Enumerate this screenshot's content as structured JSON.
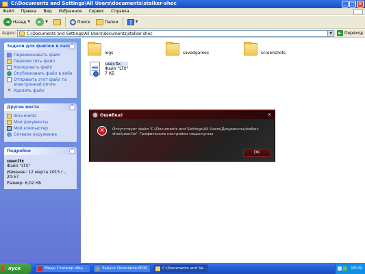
{
  "window": {
    "title": "C:\\Documents and Settings\\All Users\\documents\\stalker-shoc"
  },
  "menu": [
    "Файл",
    "Правка",
    "Вид",
    "Избранное",
    "Сервис",
    "Справка"
  ],
  "toolbar": {
    "back_label": "Назад",
    "search_label": "Поиск",
    "folders_label": "Папки"
  },
  "address": {
    "label": "Адрес:",
    "value": "C:\\Documents and Settings\\All Users\\documents\\stalker-shoc",
    "go_label": "Переход"
  },
  "tasks_panel": {
    "title": "Задачи для файлов и папок",
    "items": [
      "Переименовать файл",
      "Переместить файл",
      "Копировать файл",
      "Опубликовать файл в вебе",
      "Отправить этот файл по электронной почте",
      "Удалить файл"
    ]
  },
  "places_panel": {
    "title": "Другие места",
    "items": [
      "documents",
      "Мои документы",
      "Мой компьютер",
      "Сетевое окружение"
    ]
  },
  "details_panel": {
    "title": "Подробно",
    "name": "user.ltx",
    "type": "Файл \"LTX\"",
    "modified": "Изменен: 12 марта 2015 г., 20:57",
    "size": "Размер: 6,02 КБ"
  },
  "files": {
    "folders": [
      "logs",
      "savedgames",
      "screenshots"
    ],
    "file": {
      "name": "user.ltx",
      "type": "Файл \"LTX\"",
      "size": "7 КБ"
    }
  },
  "dialog": {
    "title": "Ошибка!",
    "message": "Отсутствует файл 'C:\\Documents and Settings\\All Users\\Документы\\stalker-shoc\\user.ltx'. Графические настройки недоступны",
    "ok_label": "OK"
  },
  "taskbar": {
    "start_label": "пуск",
    "tasks": [
      "Моды Сталкер общ...",
      "Запуск Oscorianie-MOD",
      "C:\\Documents and Se..."
    ],
    "clock": "18:32"
  }
}
